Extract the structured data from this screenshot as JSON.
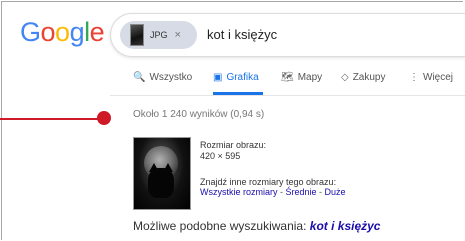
{
  "logo": {
    "letters": [
      "G",
      "o",
      "o",
      "g",
      "l",
      "e"
    ],
    "colors": [
      "#4285f4",
      "#ea4335",
      "#fbbc05",
      "#4285f4",
      "#34a853",
      "#ea4335"
    ]
  },
  "search": {
    "chip": {
      "label": "JPG",
      "close": "×",
      "thumb_icon": "image-thumb-icon"
    },
    "query": "kot i księżyc"
  },
  "tabs": [
    {
      "label": "Wszystko",
      "icon": "🔍",
      "icon_name": "search-icon",
      "active": false
    },
    {
      "label": "Grafika",
      "icon": "▣",
      "icon_name": "image-icon",
      "active": true
    },
    {
      "label": "Mapy",
      "icon": "🗺",
      "icon_name": "map-icon",
      "active": false
    },
    {
      "label": "Zakupy",
      "icon": "◇",
      "icon_name": "tag-icon",
      "active": false
    },
    {
      "label": "Więcej",
      "icon": "⋮",
      "icon_name": "more-vert-icon",
      "active": false
    }
  ],
  "stats": "Około 1 240 wyników (0,94 s)",
  "image_info": {
    "size_label": "Rozmiar obrazu:",
    "size_value": "420 × 595",
    "other_label": "Znajdź inne rozmiary tego obrazu:",
    "links": [
      "Wszystkie rozmiary",
      "Średnie",
      "Duże"
    ],
    "separator": " - "
  },
  "suggestion": {
    "prefix": "Możliwe podobne wyszukiwania: ",
    "link": "kot i księżyc"
  },
  "accent_colors": {
    "active_tab": "#1a73e8",
    "link": "#1a0dab",
    "annotation": "#d01927"
  }
}
